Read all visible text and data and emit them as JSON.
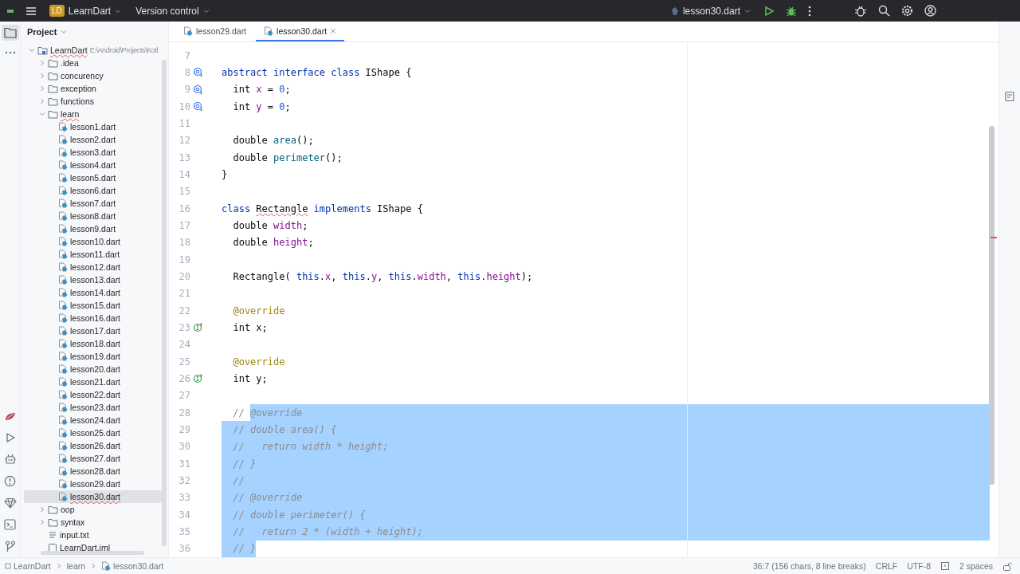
{
  "title_bar": {
    "project_badge": "LD",
    "project": "LearnDart",
    "vcs": "Version control",
    "run_config": "lesson30.dart"
  },
  "project_panel": {
    "title": "Project",
    "tree": [
      {
        "label": "LearnDart",
        "kind": "module",
        "path": "E:\\Android\\Projects\\Kotl",
        "typo": true,
        "expanded": true,
        "selected": false,
        "children": [
          {
            "label": ".idea",
            "kind": "folder",
            "expanded": false,
            "selected": false
          },
          {
            "label": "concurency",
            "kind": "folder",
            "expanded": false,
            "selected": false
          },
          {
            "label": "exception",
            "kind": "folder",
            "expanded": false,
            "selected": false
          },
          {
            "label": "functions",
            "kind": "folder",
            "expanded": false,
            "selected": false
          },
          {
            "label": "learn",
            "kind": "folder",
            "typo": true,
            "expanded": true,
            "selected": false,
            "children": [
              {
                "label": "lesson1.dart",
                "kind": "dart",
                "selected": false
              },
              {
                "label": "lesson2.dart",
                "kind": "dart",
                "selected": false
              },
              {
                "label": "lesson3.dart",
                "kind": "dart",
                "selected": false
              },
              {
                "label": "lesson4.dart",
                "kind": "dart",
                "selected": false
              },
              {
                "label": "lesson5.dart",
                "kind": "dart",
                "selected": false
              },
              {
                "label": "lesson6.dart",
                "kind": "dart",
                "selected": false
              },
              {
                "label": "lesson7.dart",
                "kind": "dart",
                "selected": false
              },
              {
                "label": "lesson8.dart",
                "kind": "dart",
                "selected": false
              },
              {
                "label": "lesson9.dart",
                "kind": "dart",
                "selected": false
              },
              {
                "label": "lesson10.dart",
                "kind": "dart",
                "selected": false
              },
              {
                "label": "lesson11.dart",
                "kind": "dart",
                "selected": false
              },
              {
                "label": "lesson12.dart",
                "kind": "dart",
                "selected": false
              },
              {
                "label": "lesson13.dart",
                "kind": "dart",
                "selected": false
              },
              {
                "label": "lesson14.dart",
                "kind": "dart",
                "selected": false
              },
              {
                "label": "lesson15.dart",
                "kind": "dart",
                "selected": false
              },
              {
                "label": "lesson16.dart",
                "kind": "dart",
                "selected": false
              },
              {
                "label": "lesson17.dart",
                "kind": "dart",
                "selected": false
              },
              {
                "label": "lesson18.dart",
                "kind": "dart",
                "selected": false
              },
              {
                "label": "lesson19.dart",
                "kind": "dart",
                "selected": false
              },
              {
                "label": "lesson20.dart",
                "kind": "dart",
                "selected": false
              },
              {
                "label": "lesson21.dart",
                "kind": "dart",
                "selected": false
              },
              {
                "label": "lesson22.dart",
                "kind": "dart",
                "selected": false
              },
              {
                "label": "lesson23.dart",
                "kind": "dart",
                "selected": false
              },
              {
                "label": "lesson24.dart",
                "kind": "dart",
                "selected": false
              },
              {
                "label": "lesson25.dart",
                "kind": "dart",
                "selected": false
              },
              {
                "label": "lesson26.dart",
                "kind": "dart",
                "selected": false
              },
              {
                "label": "lesson27.dart",
                "kind": "dart",
                "selected": false
              },
              {
                "label": "lesson28.dart",
                "kind": "dart",
                "selected": false
              },
              {
                "label": "lesson29.dart",
                "kind": "dart",
                "selected": false
              },
              {
                "label": "lesson30.dart",
                "kind": "dart",
                "typo": true,
                "selected": true
              }
            ]
          },
          {
            "label": "oop",
            "kind": "folder",
            "expanded": false,
            "selected": false
          },
          {
            "label": "syntax",
            "kind": "folder",
            "expanded": false,
            "selected": false
          },
          {
            "label": "input.txt",
            "kind": "text",
            "selected": false
          },
          {
            "label": "LearnDart.iml",
            "kind": "iml",
            "selected": false
          }
        ]
      }
    ]
  },
  "editor_tabs": [
    {
      "label": "lesson29.dart",
      "selected": false
    },
    {
      "label": "lesson30.dart",
      "selected": true
    }
  ],
  "code_lines": [
    {
      "number": "7",
      "selected": false,
      "kind": "plain"
    },
    {
      "number": "8",
      "selected": false,
      "kind": "implemented",
      "tokens": [
        {
          "text": "abstract interface class",
          "kind": "keyword"
        },
        {
          "text": " IShape {",
          "kind": "plain"
        }
      ]
    },
    {
      "number": "9",
      "selected": false,
      "kind": "implemented",
      "tokens": [
        {
          "text": "  int ",
          "kind": "plain"
        },
        {
          "text": "x",
          "kind": "field"
        },
        {
          "text": " = ",
          "kind": "plain"
        },
        {
          "text": "0",
          "kind": "number"
        },
        {
          "text": ";",
          "kind": "plain"
        }
      ]
    },
    {
      "number": "10",
      "selected": false,
      "kind": "implemented",
      "tokens": [
        {
          "text": "  int ",
          "kind": "plain"
        },
        {
          "text": "y",
          "kind": "field"
        },
        {
          "text": " = ",
          "kind": "plain"
        },
        {
          "text": "0",
          "kind": "number"
        },
        {
          "text": ";",
          "kind": "plain"
        }
      ]
    },
    {
      "number": "11",
      "selected": false,
      "kind": "plain"
    },
    {
      "number": "12",
      "selected": false,
      "kind": "plain",
      "tokens": [
        {
          "text": "  double ",
          "kind": "plain"
        },
        {
          "text": "area",
          "kind": "method"
        },
        {
          "text": "();",
          "kind": "plain"
        }
      ]
    },
    {
      "number": "13",
      "selected": false,
      "kind": "plain",
      "tokens": [
        {
          "text": "  double ",
          "kind": "plain"
        },
        {
          "text": "perimeter",
          "kind": "method"
        },
        {
          "text": "();",
          "kind": "plain"
        }
      ]
    },
    {
      "number": "14",
      "selected": false,
      "kind": "plain",
      "tokens": [
        {
          "text": "}",
          "kind": "plain"
        }
      ]
    },
    {
      "number": "15",
      "selected": false,
      "kind": "plain"
    },
    {
      "number": "16",
      "selected": false,
      "kind": "plain",
      "tokens": [
        {
          "text": "class ",
          "kind": "keyword"
        },
        {
          "text": "Rectangle",
          "kind": "plain",
          "typo": true
        },
        {
          "text": " implements",
          "kind": "keyword"
        },
        {
          "text": " IShape {",
          "kind": "plain"
        }
      ]
    },
    {
      "number": "17",
      "selected": false,
      "kind": "plain",
      "tokens": [
        {
          "text": "  double ",
          "kind": "plain"
        },
        {
          "text": "width",
          "kind": "field"
        },
        {
          "text": ";",
          "kind": "plain"
        }
      ]
    },
    {
      "number": "18",
      "selected": false,
      "kind": "plain",
      "tokens": [
        {
          "text": "  double ",
          "kind": "plain"
        },
        {
          "text": "height",
          "kind": "field"
        },
        {
          "text": ";",
          "kind": "plain"
        }
      ]
    },
    {
      "number": "19",
      "selected": false,
      "kind": "plain"
    },
    {
      "number": "20",
      "selected": false,
      "kind": "plain",
      "tokens": [
        {
          "text": "  Rectangle( ",
          "kind": "plain"
        },
        {
          "text": "this",
          "kind": "keyword"
        },
        {
          "text": ".",
          "kind": "plain"
        },
        {
          "text": "x",
          "kind": "field"
        },
        {
          "text": ", ",
          "kind": "plain"
        },
        {
          "text": "this",
          "kind": "keyword"
        },
        {
          "text": ".",
          "kind": "plain"
        },
        {
          "text": "y",
          "kind": "field"
        },
        {
          "text": ", ",
          "kind": "plain"
        },
        {
          "text": "this",
          "kind": "keyword"
        },
        {
          "text": ".",
          "kind": "plain"
        },
        {
          "text": "width",
          "kind": "field"
        },
        {
          "text": ", ",
          "kind": "plain"
        },
        {
          "text": "this",
          "kind": "keyword"
        },
        {
          "text": ".",
          "kind": "plain"
        },
        {
          "text": "height",
          "kind": "field"
        },
        {
          "text": ");",
          "kind": "plain"
        }
      ]
    },
    {
      "number": "21",
      "selected": false,
      "kind": "plain"
    },
    {
      "number": "22",
      "selected": false,
      "kind": "plain",
      "tokens": [
        {
          "text": "  @override",
          "kind": "annotation"
        }
      ]
    },
    {
      "number": "23",
      "selected": false,
      "kind": "overrides",
      "tokens": [
        {
          "text": "  int x;",
          "kind": "plain"
        }
      ]
    },
    {
      "number": "24",
      "selected": false,
      "kind": "plain"
    },
    {
      "number": "25",
      "selected": false,
      "kind": "plain",
      "tokens": [
        {
          "text": "  @override",
          "kind": "annotation"
        }
      ]
    },
    {
      "number": "26",
      "selected": false,
      "kind": "overrides",
      "tokens": [
        {
          "text": "  int y;",
          "kind": "plain"
        }
      ]
    },
    {
      "number": "27",
      "selected": false,
      "kind": "plain"
    },
    {
      "number": "28",
      "selected": true,
      "kind": "plain",
      "tokens": [
        {
          "text": "  // ",
          "kind": "comment",
          "selected": false
        },
        {
          "text": "@override",
          "kind": "comment",
          "selected": true
        }
      ]
    },
    {
      "number": "29",
      "selected": true,
      "kind": "plain",
      "tokens": [
        {
          "text": "  // double area() {",
          "kind": "comment"
        }
      ]
    },
    {
      "number": "30",
      "selected": true,
      "kind": "plain",
      "tokens": [
        {
          "text": "  //   return width * height;",
          "kind": "comment"
        }
      ]
    },
    {
      "number": "31",
      "selected": true,
      "kind": "plain",
      "tokens": [
        {
          "text": "  // }",
          "kind": "comment"
        }
      ]
    },
    {
      "number": "32",
      "selected": true,
      "kind": "plain",
      "tokens": [
        {
          "text": "  //",
          "kind": "comment"
        }
      ]
    },
    {
      "number": "33",
      "selected": true,
      "kind": "plain",
      "tokens": [
        {
          "text": "  // @override",
          "kind": "comment"
        }
      ]
    },
    {
      "number": "34",
      "selected": true,
      "kind": "plain",
      "tokens": [
        {
          "text": "  // double perimeter() {",
          "kind": "comment"
        }
      ]
    },
    {
      "number": "35",
      "selected": true,
      "kind": "plain",
      "tokens": [
        {
          "text": "  //   return 2 * (width + height);",
          "kind": "comment"
        }
      ]
    },
    {
      "number": "36",
      "selected": false,
      "kind": "plain",
      "tokens": [
        {
          "text": "  // }",
          "kind": "comment",
          "selected": true
        }
      ]
    }
  ],
  "status_bar": {
    "breadcrumbs": [
      {
        "label": "LearnDart",
        "kind": "module"
      },
      {
        "label": "learn",
        "kind": "folder"
      },
      {
        "label": "lesson30.dart",
        "kind": "dart"
      }
    ],
    "position": "36:7 (156 chars, 8 line breaks)",
    "line_separator": "CRLF",
    "encoding": "UTF-8",
    "indent": "2 spaces"
  }
}
